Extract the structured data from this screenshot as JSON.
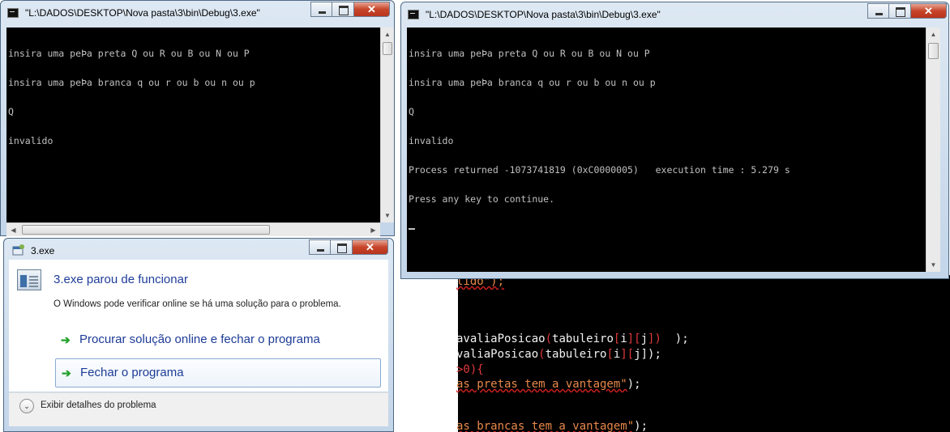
{
  "editor": {
    "lines": [
      {
        "parts": [
          {
            "text": "lido\");",
            "cls": "c-str squig"
          }
        ]
      },
      {
        "parts": [
          {
            "text": "avaliaPosicao",
            "cls": "c-white"
          },
          {
            "text": "(",
            "cls": "c-red"
          },
          {
            "text": "tabuleiro",
            "cls": "c-white"
          },
          {
            "text": "[",
            "cls": "c-red"
          },
          {
            "text": "i",
            "cls": "c-white"
          },
          {
            "text": "][",
            "cls": "c-red"
          },
          {
            "text": "j",
            "cls": "c-white"
          },
          {
            "text": "])",
            "cls": "c-red"
          },
          {
            "text": "  ",
            "cls": "c-white"
          },
          {
            "text": ");",
            "cls": "c-white"
          }
        ]
      },
      {
        "parts": [
          {
            "text": "valiaPosicao",
            "cls": "c-white"
          },
          {
            "text": "(",
            "cls": "c-red"
          },
          {
            "text": "tabuleiro",
            "cls": "c-white"
          },
          {
            "text": "[",
            "cls": "c-red"
          },
          {
            "text": "i",
            "cls": "c-white"
          },
          {
            "text": "][",
            "cls": "c-red"
          },
          {
            "text": "j",
            "cls": "c-white"
          },
          {
            "text": "]);",
            "cls": "c-white"
          }
        ]
      },
      {
        "parts": [
          {
            "text": ">0){",
            "cls": "c-red"
          }
        ]
      },
      {
        "parts": [
          {
            "text": "as pretas tem a vantagem\"",
            "cls": "c-str squig"
          },
          {
            "text": ");",
            "cls": "c-white"
          }
        ]
      },
      {
        "parts": [
          {
            "text": "as brancas tem a vantagem\"",
            "cls": "c-str squig"
          },
          {
            "text": ");",
            "cls": "c-white"
          }
        ]
      }
    ]
  },
  "console_left": {
    "title": "\"L:\\DADOS\\DESKTOP\\Nova pasta\\3\\bin\\Debug\\3.exe\"",
    "lines": [
      "insira uma peÞa preta Q ou R ou B ou N ou P",
      "insira uma peÞa branca q ou r ou b ou n ou p",
      "Q",
      "invalido"
    ]
  },
  "console_right": {
    "title": "\"L:\\DADOS\\DESKTOP\\Nova pasta\\3\\bin\\Debug\\3.exe\"",
    "lines": [
      "insira uma peÞa preta Q ou R ou B ou N ou P",
      "insira uma peÞa branca q ou r ou b ou n ou p",
      "Q",
      "invalido",
      "Process returned -1073741819 (0xC0000005)   execution time : 5.279 s",
      "Press any key to continue."
    ]
  },
  "dialog": {
    "title": "3.exe",
    "heading": "3.exe parou de funcionar",
    "description": "O Windows pode verificar online se há uma solução para o problema.",
    "option_online": "Procurar solução online e fechar o programa",
    "option_close": "Fechar o programa",
    "details": "Exibir detalhes do problema"
  },
  "colors": {
    "console_bg": "#000000",
    "console_text": "#c0c0c0",
    "link_blue": "#1c3b97",
    "arrow_green": "#22a12b"
  }
}
